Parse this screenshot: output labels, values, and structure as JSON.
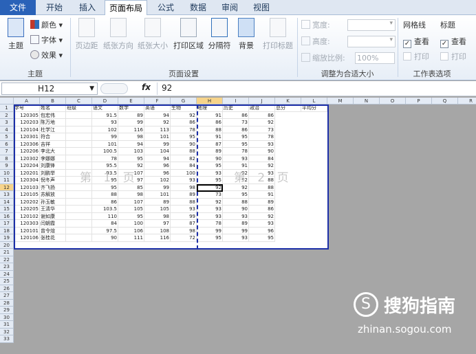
{
  "tabs": [
    "文件",
    "开始",
    "插入",
    "页面布局",
    "公式",
    "数据",
    "审阅",
    "视图"
  ],
  "active_tab": "页面布局",
  "ribbon": {
    "theme_group": {
      "label": "主题",
      "theme_btn": "主题",
      "colors": "颜色",
      "fonts": "字体",
      "effects": "效果"
    },
    "page_setup_group": {
      "label": "页面设置",
      "margins": "页边距",
      "orientation": "纸张方向",
      "size": "纸张大小",
      "print_area": "打印区域",
      "breaks": "分隔符",
      "background": "背景",
      "print_titles": "打印标题"
    },
    "scale_group": {
      "label": "调整为合适大小",
      "width": "宽度:",
      "height": "高度:",
      "scale": "缩放比例:",
      "scale_value": "100%"
    },
    "sheet_options_group": {
      "label": "工作表选项",
      "gridlines": "网格线",
      "headings": "标题",
      "view1": "查看",
      "print1": "打印",
      "view2": "查看",
      "print2": "打印"
    }
  },
  "namebox": "H12",
  "formula_value": "92",
  "columns": [
    "A",
    "B",
    "C",
    "D",
    "E",
    "F",
    "G",
    "H",
    "I",
    "J",
    "K",
    "L",
    "M",
    "N",
    "O",
    "P",
    "Q",
    "R"
  ],
  "header_row": [
    "学号",
    "姓名",
    "班级",
    "语文",
    "数学",
    "英语",
    "生物",
    "地理",
    "历史",
    "政治",
    "总分",
    "平均分"
  ],
  "rows": [
    [
      "120305",
      "包宏伟",
      "",
      "91.5",
      "89",
      "94",
      "92",
      "91",
      "86",
      "86"
    ],
    [
      "120203",
      "陈万地",
      "",
      "93",
      "99",
      "92",
      "86",
      "86",
      "73",
      "92"
    ],
    [
      "120104",
      "杜学江",
      "",
      "102",
      "116",
      "113",
      "78",
      "88",
      "86",
      "73"
    ],
    [
      "120301",
      "符合",
      "",
      "99",
      "98",
      "101",
      "95",
      "91",
      "95",
      "78"
    ],
    [
      "120306",
      "吉祥",
      "",
      "101",
      "94",
      "99",
      "90",
      "87",
      "95",
      "93"
    ],
    [
      "120206",
      "李北大",
      "",
      "100.5",
      "103",
      "104",
      "88",
      "89",
      "78",
      "90"
    ],
    [
      "120302",
      "李娜娜",
      "",
      "78",
      "95",
      "94",
      "82",
      "90",
      "93",
      "84"
    ],
    [
      "120204",
      "刘康锋",
      "",
      "95.5",
      "92",
      "96",
      "84",
      "95",
      "91",
      "92"
    ],
    [
      "120201",
      "刘鹏举",
      "",
      "93.5",
      "107",
      "96",
      "100",
      "93",
      "92",
      "93"
    ],
    [
      "120304",
      "倪冬声",
      "",
      "95",
      "97",
      "102",
      "93",
      "95",
      "92",
      "88"
    ],
    [
      "120103",
      "齐飞扬",
      "",
      "95",
      "85",
      "99",
      "98",
      "92",
      "92",
      "88"
    ],
    [
      "120105",
      "苏解放",
      "",
      "88",
      "98",
      "101",
      "89",
      "73",
      "95",
      "91"
    ],
    [
      "120202",
      "孙玉敏",
      "",
      "86",
      "107",
      "89",
      "88",
      "92",
      "88",
      "89"
    ],
    [
      "120205",
      "王清华",
      "",
      "103.5",
      "105",
      "105",
      "93",
      "93",
      "90",
      "86"
    ],
    [
      "120102",
      "谢如康",
      "",
      "110",
      "95",
      "98",
      "99",
      "93",
      "93",
      "92"
    ],
    [
      "120303",
      "闫朝霞",
      "",
      "84",
      "100",
      "97",
      "87",
      "78",
      "89",
      "93"
    ],
    [
      "120101",
      "曾令煊",
      "",
      "97.5",
      "106",
      "108",
      "98",
      "99",
      "99",
      "96"
    ],
    [
      "120106",
      "张桂花",
      "",
      "90",
      "111",
      "116",
      "72",
      "95",
      "93",
      "95"
    ]
  ],
  "row_numbers": [
    "1",
    "2",
    "3",
    "4",
    "5",
    "6",
    "7",
    "8",
    "9",
    "10",
    "11",
    "12",
    "13",
    "14",
    "15",
    "16",
    "17",
    "18",
    "19",
    "20",
    "21",
    "22",
    "23",
    "24",
    "25",
    "26",
    "27",
    "28",
    "29",
    "30",
    "31",
    "32",
    "33"
  ],
  "watermark1": "第 1 页",
  "watermark2": "第 2 页",
  "sogou_brand": "搜狗指南",
  "sogou_url": "zhinan.sogou.com"
}
